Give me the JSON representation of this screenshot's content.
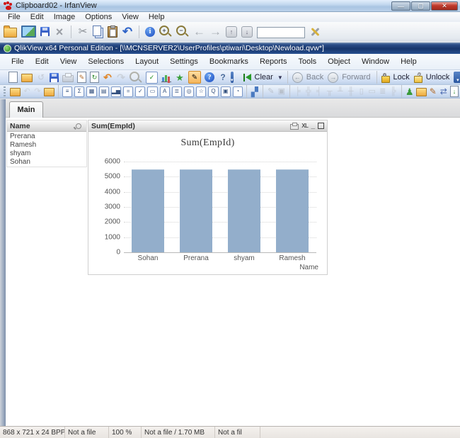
{
  "irfanview": {
    "title": "Clipboard02 - IrfanView",
    "menus": [
      "File",
      "Edit",
      "Image",
      "Options",
      "View",
      "Help"
    ],
    "window_buttons": [
      "minimize",
      "maximize",
      "close"
    ],
    "toolbar": [
      {
        "n": "open-icon",
        "k": "folder"
      },
      {
        "n": "slideshow-icon",
        "k": "image"
      },
      {
        "n": "save-icon",
        "k": "floppy"
      },
      {
        "n": "delete-icon",
        "k": "g",
        "g": "×",
        "c": "#9a9ea5",
        "s": 18,
        "b": 1
      },
      {
        "n": "sep"
      },
      {
        "n": "cut-icon",
        "k": "g",
        "g": "✂",
        "c": "#8a8f96",
        "s": 15
      },
      {
        "n": "copy-icon",
        "k": "copy"
      },
      {
        "n": "paste-icon",
        "k": "paste"
      },
      {
        "n": "undo-icon",
        "k": "g",
        "g": "↶",
        "c": "#2f64c8",
        "s": 17,
        "b": 1
      },
      {
        "n": "sep"
      },
      {
        "n": "info-icon",
        "k": "info",
        "g": "i"
      },
      {
        "n": "zoom-in-icon",
        "k": "mag",
        "g": "+"
      },
      {
        "n": "zoom-out-icon",
        "k": "mag",
        "g": "−"
      },
      {
        "n": "prev-image-icon",
        "k": "g",
        "g": "←",
        "c": "#a8adb4",
        "s": 17,
        "b": 1
      },
      {
        "n": "next-image-icon",
        "k": "g",
        "g": "→",
        "c": "#a8adb4",
        "s": 17,
        "b": 1
      },
      {
        "n": "first-page-icon",
        "k": "pg",
        "g": "↑"
      },
      {
        "n": "last-page-icon",
        "k": "pg",
        "g": "↓"
      },
      {
        "n": "page-number-input",
        "k": "input"
      },
      {
        "n": "properties-tools-icon",
        "k": "tools"
      },
      {
        "n": "irfanview-logo-icon",
        "k": "paw"
      }
    ],
    "status_segments": [
      "868 x 721 x 24 BPP",
      "Not a file",
      "100 %",
      "Not a file / 1.70 MB",
      "Not a fil"
    ],
    "status_widths": [
      92,
      62,
      46,
      104,
      64
    ]
  },
  "qlikview": {
    "title": "QlikView x64 Personal Edition - [\\\\MCNSERVER2\\UserProfiles\\ptiwari\\Desktop\\Newload.qvw*]",
    "menus": [
      "File",
      "Edit",
      "View",
      "Selections",
      "Layout",
      "Settings",
      "Bookmarks",
      "Reports",
      "Tools",
      "Object",
      "Window",
      "Help"
    ],
    "standard_toolbar": [
      {
        "n": "new-document-icon",
        "k": "page"
      },
      {
        "n": "open-icon",
        "k": "folder2"
      },
      {
        "n": "refresh-icon",
        "k": "g",
        "g": "↺",
        "c": "#aab4c2",
        "d": 1
      },
      {
        "n": "save-icon",
        "k": "floppy"
      },
      {
        "n": "print-icon",
        "k": "printer",
        "d": 1
      },
      {
        "n": "edit-script-icon",
        "k": "pagex",
        "g": "✎",
        "c": "#b06a2a"
      },
      {
        "n": "reload-data-icon",
        "k": "pagex",
        "g": "↻",
        "c": "#2a8a2a"
      },
      {
        "n": "undo-icon",
        "k": "g",
        "g": "↶",
        "c": "#e0872a",
        "s": 14,
        "b": 1
      },
      {
        "n": "redo-icon",
        "k": "g",
        "g": "↷",
        "c": "#b6bcc6",
        "s": 14,
        "b": 1,
        "d": 1
      },
      {
        "n": "search-icon",
        "k": "mag",
        "g": "",
        "d": 1
      },
      {
        "n": "current-selections-icon",
        "k": "tbx",
        "g": "✓",
        "c": "#1a8a1a"
      },
      {
        "n": "quick-chart-wizard-icon",
        "k": "bars"
      },
      {
        "n": "favorites-icon",
        "k": "g",
        "g": "★",
        "c": "#3aa03a",
        "s": 13
      },
      {
        "n": "edit-mode-icon",
        "k": "hl",
        "g": "✎"
      },
      {
        "n": "help-icon",
        "k": "info",
        "g": "?"
      },
      {
        "n": "whats-this-icon",
        "k": "g",
        "g": "?",
        "c": "#4a6a9a",
        "s": 12,
        "b": 1
      }
    ],
    "nav_toolbar": {
      "clear_label": "Clear",
      "back_label": "Back",
      "forward_label": "Forward",
      "lock_label": "Lock",
      "unlock_label": "Unlock"
    },
    "design_toolbar": [
      {
        "n": "new-sheet-icon",
        "k": "folder2"
      },
      {
        "n": "promote-sheet-icon",
        "k": "g",
        "g": "↶",
        "c": "#b8bec8",
        "d": 1
      },
      {
        "n": "demote-sheet-icon",
        "k": "g",
        "g": "↷",
        "c": "#b8bec8",
        "d": 1
      },
      {
        "n": "sheet-properties-icon",
        "k": "folder2"
      },
      {
        "n": "sep"
      },
      {
        "n": "create-listbox-icon",
        "k": "tbx",
        "g": "≡"
      },
      {
        "n": "create-statistics-box-icon",
        "k": "tbx",
        "g": "Σ"
      },
      {
        "n": "create-table-box-icon",
        "k": "tbx",
        "g": "▦"
      },
      {
        "n": "create-input-box-icon",
        "k": "tbx",
        "g": "▤"
      },
      {
        "n": "create-chart-icon",
        "k": "tbx",
        "g": "▂▅"
      },
      {
        "n": "create-multi-box-icon",
        "k": "tbx",
        "g": "="
      },
      {
        "n": "create-button-icon",
        "k": "tbx",
        "g": "✓"
      },
      {
        "n": "create-text-object-icon",
        "k": "tbx",
        "g": "▭"
      },
      {
        "n": "create-text-icon",
        "k": "tbx",
        "g": "A"
      },
      {
        "n": "create-slider-icon",
        "k": "tbx",
        "g": "≣"
      },
      {
        "n": "create-bookmark-object-icon",
        "k": "tbx",
        "g": "◎"
      },
      {
        "n": "create-star-object-icon",
        "k": "tbx",
        "g": "☆"
      },
      {
        "n": "create-search-object-icon",
        "k": "tbx",
        "g": "Q"
      },
      {
        "n": "create-container-icon",
        "k": "tbx",
        "g": "▣"
      },
      {
        "n": "create-calendar-icon",
        "k": "tbx",
        "g": "◔"
      },
      {
        "n": "sep"
      },
      {
        "n": "wizard-icon",
        "k": "g",
        "g": "▞",
        "c": "#4a7ac0",
        "s": 13
      },
      {
        "n": "sep"
      },
      {
        "n": "format-painter-icon",
        "k": "g",
        "g": "✎",
        "c": "#9aa2ae",
        "d": 1
      },
      {
        "n": "grid-design-icon",
        "k": "g",
        "g": "▣",
        "c": "#9aa2ae",
        "d": 1
      },
      {
        "n": "sep"
      },
      {
        "n": "align-left-icon",
        "k": "g",
        "g": "╞",
        "c": "#aab2be",
        "d": 1
      },
      {
        "n": "align-center-icon",
        "k": "g",
        "g": "╬",
        "c": "#aab2be",
        "d": 1
      },
      {
        "n": "align-right-icon",
        "k": "g",
        "g": "╡",
        "c": "#aab2be",
        "d": 1
      },
      {
        "n": "align-top-icon",
        "k": "g",
        "g": "╥",
        "c": "#aab2be",
        "d": 1
      },
      {
        "n": "align-bottom-icon",
        "k": "g",
        "g": "╨",
        "c": "#aab2be",
        "d": 1
      },
      {
        "n": "space-horizontal-icon",
        "k": "g",
        "g": "╫",
        "c": "#aab2be",
        "d": 1
      },
      {
        "n": "space-vertical-icon",
        "k": "g",
        "g": "▯",
        "c": "#aab2be",
        "d": 1
      },
      {
        "n": "adjust-left-icon",
        "k": "g",
        "g": "▭",
        "c": "#aab2be",
        "d": 1
      },
      {
        "n": "adjust-top-icon",
        "k": "g",
        "g": "≣",
        "c": "#aab2be",
        "d": 1
      },
      {
        "n": "snap-grid-icon",
        "k": "g",
        "g": "╠",
        "c": "#aab2be",
        "d": 1
      },
      {
        "n": "sep"
      },
      {
        "n": "user-preferences-icon",
        "k": "g",
        "g": "♟",
        "c": "#3a9a3a",
        "s": 13
      },
      {
        "n": "open-folder-icon",
        "k": "folder2"
      },
      {
        "n": "edit-module-icon",
        "k": "g",
        "g": "✎",
        "c": "#b06a2a",
        "s": 12
      },
      {
        "n": "connect-icon",
        "k": "g",
        "g": "⇄",
        "c": "#4a6ab0",
        "s": 12
      },
      {
        "n": "export-page-icon",
        "k": "pagex",
        "g": "↓",
        "c": "#2a8a2a"
      }
    ],
    "sheet_tab": "Main",
    "listbox": {
      "title": "Name",
      "items": [
        "Prerana",
        "Ramesh",
        "shyam",
        "Sohan"
      ]
    },
    "chart_window": {
      "caption": "Sum(EmpId)",
      "caption_icons": [
        "print-icon",
        "send-to-excel-icon",
        "minimize-icon",
        "maximize-icon"
      ]
    }
  },
  "chart_data": {
    "type": "bar",
    "title": "Sum(EmpId)",
    "categories": [
      "Sohan",
      "Prerana",
      "shyam",
      "Ramesh"
    ],
    "values": [
      5450,
      5450,
      5450,
      5450
    ],
    "xlabel": "Name",
    "ylabel": "",
    "ylim": [
      0,
      6000
    ],
    "yticks": [
      0,
      1000,
      2000,
      3000,
      4000,
      5000,
      6000
    ],
    "bar_color": "#93aecb",
    "grid": "dotted horizontal",
    "legend": "none"
  }
}
